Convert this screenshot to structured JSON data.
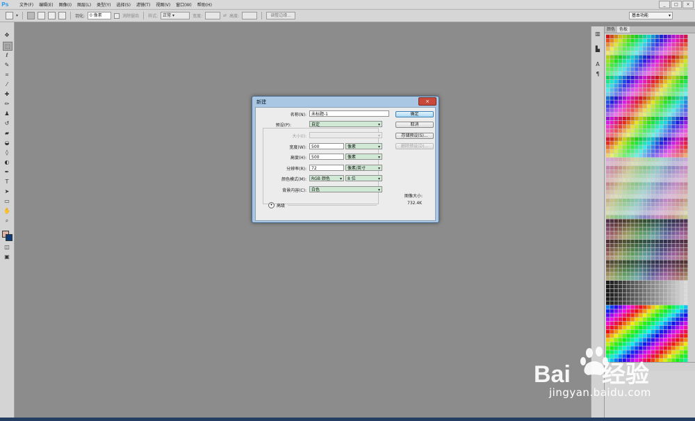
{
  "app": {
    "logo": "Ps"
  },
  "menubar": {
    "items": [
      "文件(F)",
      "编辑(E)",
      "图像(I)",
      "图层(L)",
      "类型(Y)",
      "选择(S)",
      "滤镜(T)",
      "视图(V)",
      "窗口(W)",
      "帮助(H)"
    ],
    "window_controls": [
      "_",
      "□",
      "×"
    ]
  },
  "options_bar": {
    "feather_label": "羽化:",
    "feather_value": "0 像素",
    "antialias_label": "消除锯齿",
    "style_label": "样式:",
    "style_value": "正常",
    "width_label": "宽度:",
    "height_label": "高度:",
    "refine_edge_label": "调整边缘...",
    "workspace_value": "基本功能"
  },
  "right_panel": {
    "tabs": [
      "颜色",
      "色板"
    ]
  },
  "dialog": {
    "title": "新建",
    "close": "×",
    "name_label": "名称(N):",
    "name_value": "未标题-1",
    "preset_label": "预设(P):",
    "preset_value": "自定",
    "size_label": "大小(I):",
    "size_value": "",
    "width_label": "宽度(W):",
    "width_value": "500",
    "width_unit": "像素",
    "height_label": "高度(H):",
    "height_value": "500",
    "height_unit": "像素",
    "resolution_label": "分辨率(R):",
    "resolution_value": "72",
    "resolution_unit": "像素/英寸",
    "color_mode_label": "颜色模式(M):",
    "color_mode_value": "RGB 颜色",
    "bit_depth_value": "8 位",
    "background_label": "背景内容(C):",
    "background_value": "白色",
    "advanced_label": "高级",
    "ok_button": "确定",
    "cancel_button": "取消",
    "save_preset_button": "存储预设(S)...",
    "delete_preset_button": "删除预设(D)...",
    "image_size_label": "图像大小:",
    "image_size_value": "732.4K"
  },
  "watermark": {
    "text": "jingyan.baidu.com"
  },
  "colors": {
    "menubar": "#d9d9d9",
    "workspace": "#8c8c8c",
    "dialog_frame": "#a9c7e3",
    "field_green": "#cfe9d4",
    "ok_button": "#a9d8f5",
    "close_button": "#c8483a"
  }
}
